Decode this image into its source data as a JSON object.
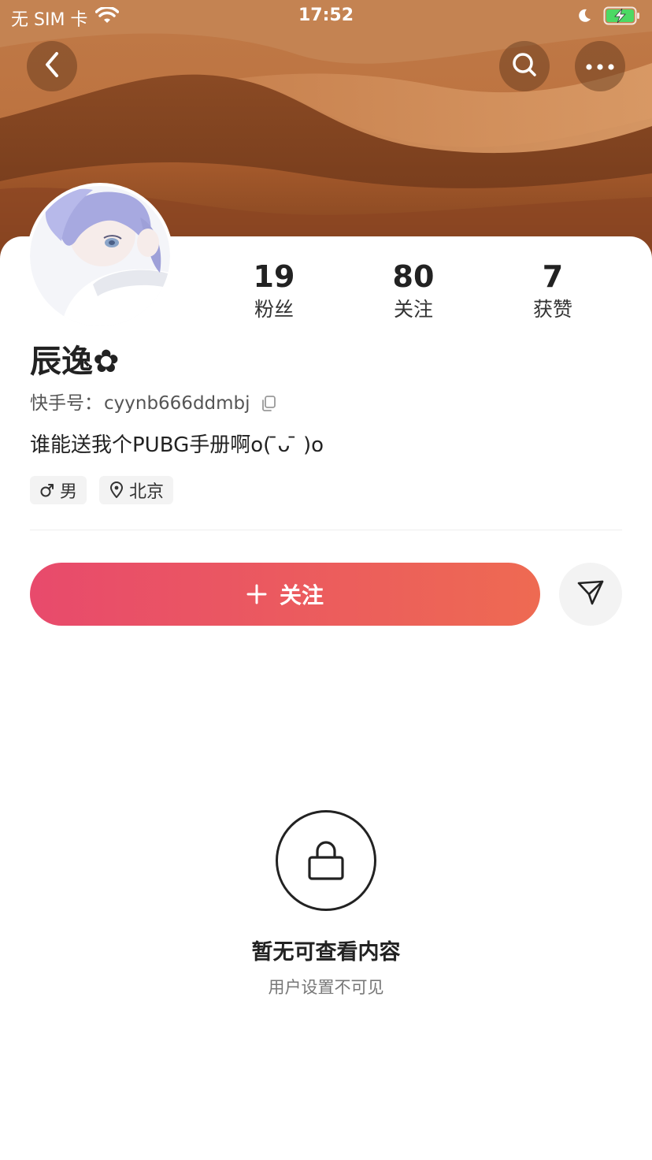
{
  "status_bar": {
    "carrier": "无 SIM 卡",
    "time": "17:52",
    "wifi_icon": "wifi-icon",
    "moon_icon": "moon-icon",
    "battery_icon": "battery-charging-icon",
    "battery_color": "#4cd964"
  },
  "header": {
    "back_icon": "chevron-left-icon",
    "search_icon": "search-icon",
    "more_icon": "more-dots-icon"
  },
  "stats": [
    {
      "value": "19",
      "label": "粉丝"
    },
    {
      "value": "80",
      "label": "关注"
    },
    {
      "value": "7",
      "label": "获赞"
    }
  ],
  "profile": {
    "name": "辰逸✿",
    "id_label": "快手号：",
    "id_value": "cyynb666ddmbj",
    "bio": "谁能送我个PUBG手册啊o( ̄ᴗ ̄ )o",
    "tags": [
      {
        "icon": "male-icon",
        "label": "男"
      },
      {
        "icon": "location-pin-icon",
        "label": "北京"
      }
    ]
  },
  "actions": {
    "follow_label": "关注",
    "follow_gradient_start": "#e84a6c",
    "follow_gradient_end": "#ee6a52",
    "send_icon": "paper-plane-icon"
  },
  "empty_state": {
    "icon": "lock-icon",
    "title": "暂无可查看内容",
    "subtitle": "用户设置不可见"
  }
}
